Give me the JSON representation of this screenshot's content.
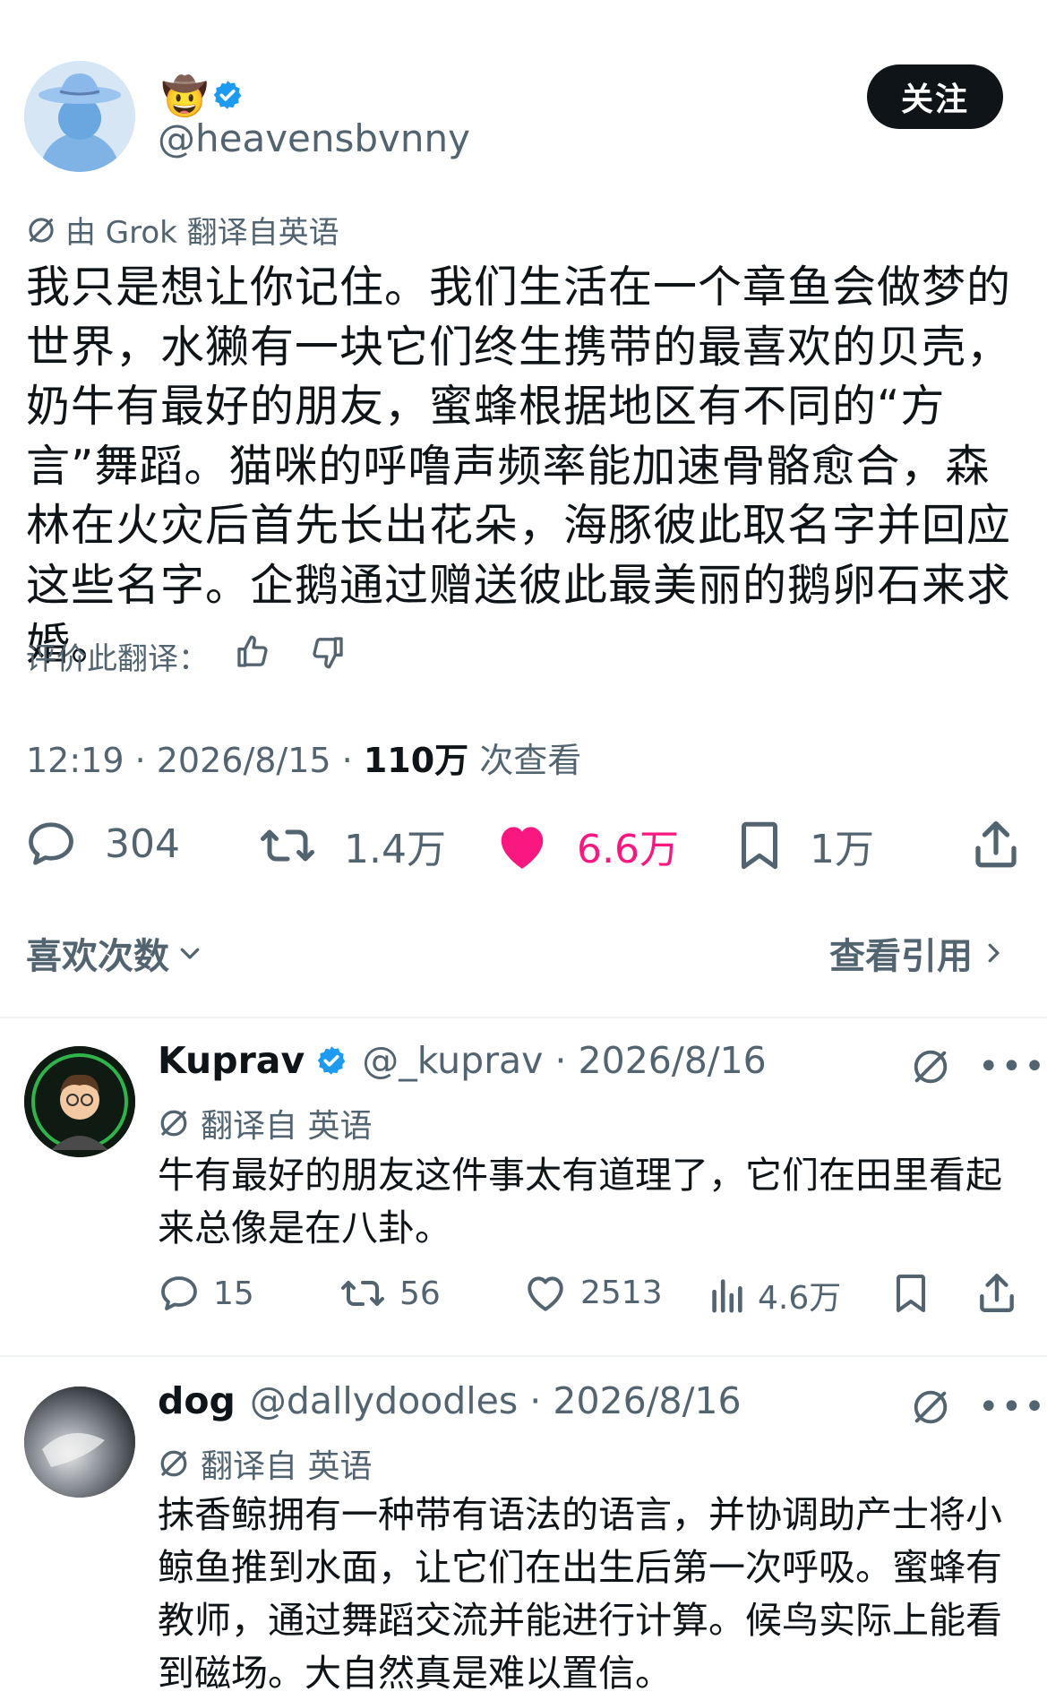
{
  "post": {
    "author": {
      "name_emoji": "🤠",
      "handle": "@heavensbvnny"
    },
    "follow_label": "关注",
    "translation_note": "由 Grok 翻译自英语",
    "text": "我只是想让你记住。我们生活在一个章鱼会做梦的世界，水獭有一块它们终生携带的最喜欢的贝壳，奶牛有最好的朋友，蜜蜂根据地区有不同的“方言”舞蹈。猫咪的呼噜声频率能加速骨骼愈合，森林在火灾后首先长出花朵，海豚彼此取名字并回应这些名字。企鹅通过赠送彼此最美丽的鹅卵石来求婚。",
    "rate_label": "评价此翻译：",
    "time": "12:19 · 2026/8/15 · ",
    "views_count": "110万",
    "views_label": " 次查看",
    "stats": {
      "replies": "304",
      "reposts": "1.4万",
      "likes": "6.6万",
      "bookmarks": "1万"
    },
    "likes_link": "喜欢次数",
    "quotes_link": "查看引用"
  },
  "replies": [
    {
      "name": "Kuprav",
      "handle": "@_kuprav · 2026/8/16",
      "translation_note": "翻译自 英语",
      "text": "牛有最好的朋友这件事太有道理了，它们在田里看起来总像是在八卦。",
      "stats": {
        "replies": "15",
        "reposts": "56",
        "likes": "2513",
        "views": "4.6万"
      }
    },
    {
      "name": "dog",
      "handle": "@dallydoodles · 2026/8/16",
      "translation_note": "翻译自 英语",
      "text": "抹香鲸拥有一种带有语法的语言，并协调助产士将小鲸鱼推到水面，让它们在出生后第一次呼吸。蜜蜂有教师，通过舞蹈交流并能进行计算。候鸟实际上能看到磁场。大自然真是难以置信。"
    }
  ],
  "more_label": "•••",
  "colors": {
    "accent": "#1d9bf0",
    "like": "#f91880",
    "text": "#0f1419",
    "secondary": "#536471"
  }
}
